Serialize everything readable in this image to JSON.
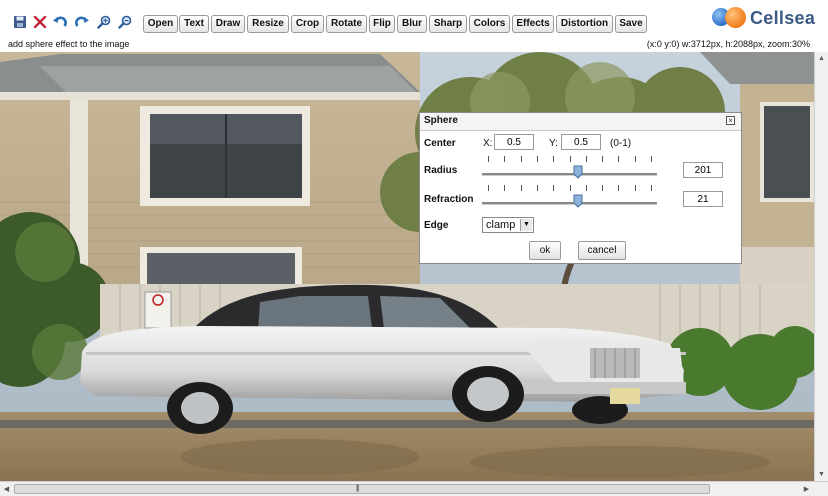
{
  "toolbar": {
    "icons": [
      "save-icon",
      "close-icon",
      "undo-icon",
      "redo-icon",
      "zoom-in-icon",
      "zoom-out-icon"
    ],
    "buttons": [
      "Open",
      "Text",
      "Draw",
      "Resize",
      "Crop",
      "Rotate",
      "Flip",
      "Blur",
      "Sharp",
      "Colors",
      "Effects",
      "Distortion",
      "Save"
    ]
  },
  "logo": {
    "text": "Cellsea"
  },
  "status": {
    "message": "add sphere effect to the image",
    "info": "(x:0 y:0) w:3712px, h:2088px, zoom:30%"
  },
  "dialog": {
    "title": "Sphere",
    "center_label": "Center",
    "x_label": "X:",
    "x_value": "0.5",
    "y_label": "Y:",
    "y_value": "0.5",
    "range_hint": "(0-1)",
    "radius_label": "Radius",
    "radius_value": "201",
    "radius_level": 0.5,
    "refraction_label": "Refraction",
    "refraction_value": "21",
    "refraction_level": 0.5,
    "edge_label": "Edge",
    "edge_value": "clamp",
    "ok_label": "ok",
    "cancel_label": "cancel"
  },
  "colors": {
    "logo_text": "#3d5a86",
    "accent_blue": "#2a6fc9",
    "accent_orange": "#f07d1a"
  }
}
